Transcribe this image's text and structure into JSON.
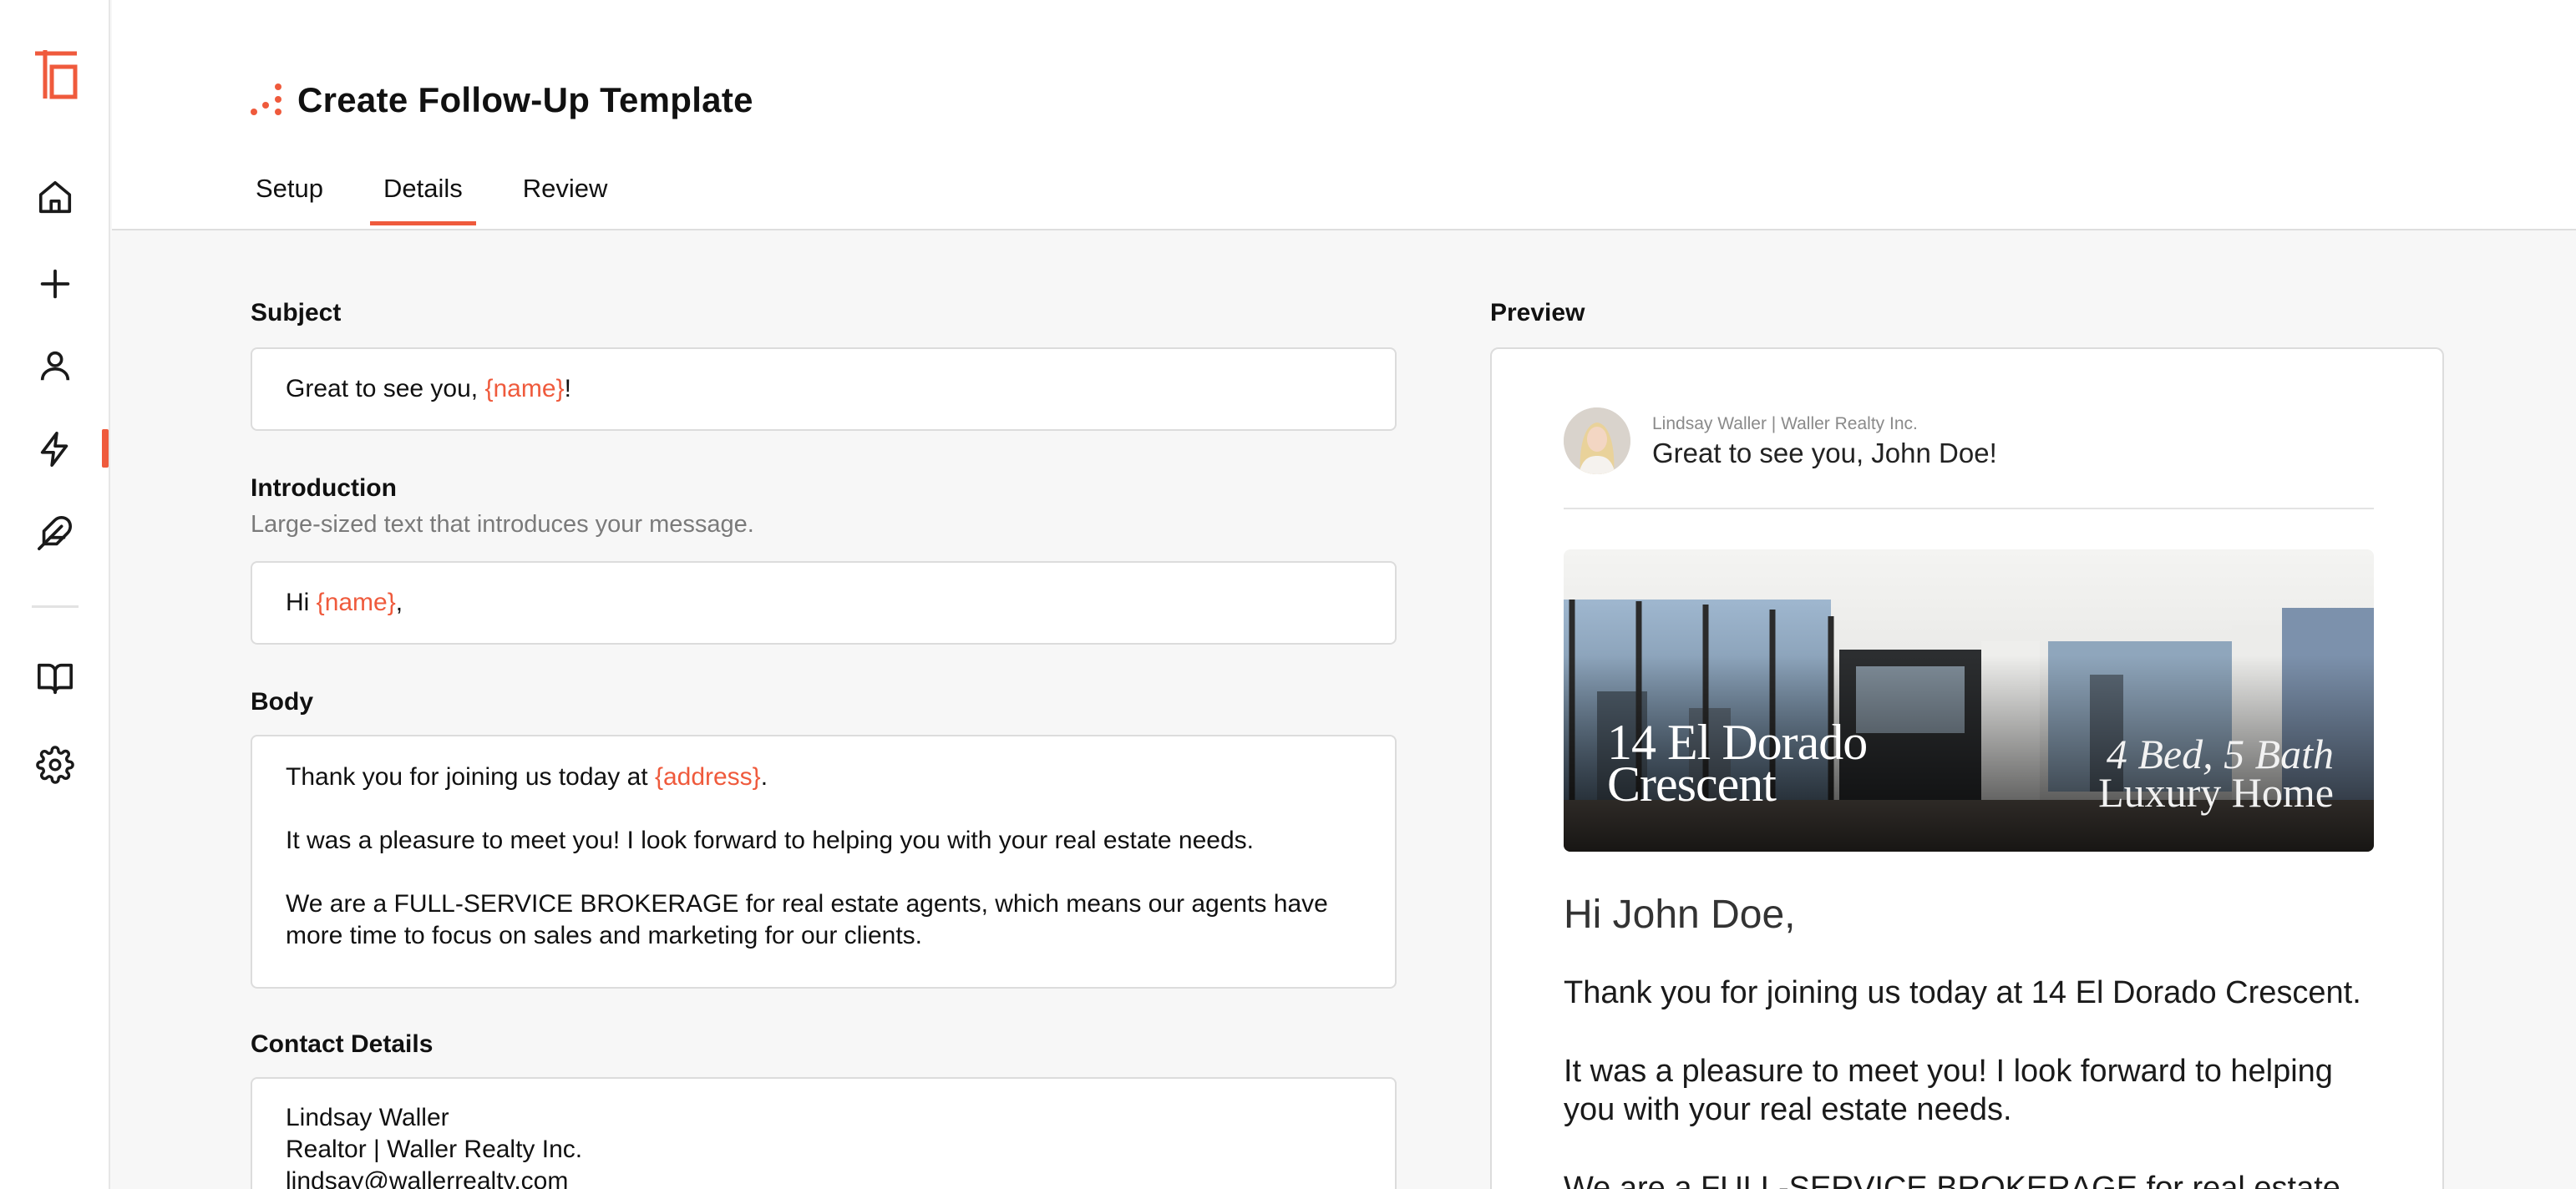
{
  "colors": {
    "accent": "#ef5a3c",
    "text": "#111111",
    "muted": "#7a7a7a",
    "border": "#dcdcdc"
  },
  "sidebar": {
    "icons": [
      "logo-icon",
      "home-icon",
      "plus-icon",
      "user-icon",
      "lightning-icon",
      "feather-icon",
      "book-icon",
      "gear-icon"
    ],
    "active_item": "lightning-icon"
  },
  "header": {
    "title": "Create Follow-Up Template",
    "tabs": [
      {
        "label": "Setup",
        "active": false
      },
      {
        "label": "Details",
        "active": true
      },
      {
        "label": "Review",
        "active": false
      }
    ]
  },
  "form": {
    "subject": {
      "label": "Subject",
      "value_prefix": "Great to see you, ",
      "value_var": "{name}",
      "value_suffix": "!"
    },
    "introduction": {
      "label": "Introduction",
      "help": "Large-sized text that introduces your message.",
      "value_prefix": "Hi ",
      "value_var": "{name}",
      "value_suffix": ","
    },
    "body": {
      "label": "Body",
      "p1_prefix": "Thank you for joining us today at ",
      "p1_var": "{address}",
      "p1_suffix": ".",
      "p2": "It was a pleasure to meet you! I look forward to helping you with your real estate needs.",
      "p3": "We are a FULL-SERVICE BROKERAGE for real estate agents, which means our agents have more time to focus on sales and marketing for our clients."
    },
    "contact": {
      "label": "Contact Details",
      "line1": "Lindsay Waller",
      "line2": "Realtor | Waller Realty Inc.",
      "line3": "lindsay@wallerrealty.com"
    }
  },
  "preview": {
    "label": "Preview",
    "sender": "Lindsay Waller | Waller Realty Inc.",
    "subject": "Great to see you, John Doe!",
    "hero": {
      "address_line1": "14 El Dorado",
      "address_line2": "Crescent",
      "beds": "4 Bed, 5 Bath",
      "type": "Luxury Home"
    },
    "greeting": "Hi John Doe,",
    "p1": "Thank you for joining us today at 14 El Dorado Crescent.",
    "p2": "It was a pleasure to meet you! I look forward to helping you with your real estate needs.",
    "p3": "We are a FULL-SERVICE BROKERAGE for real estate"
  }
}
